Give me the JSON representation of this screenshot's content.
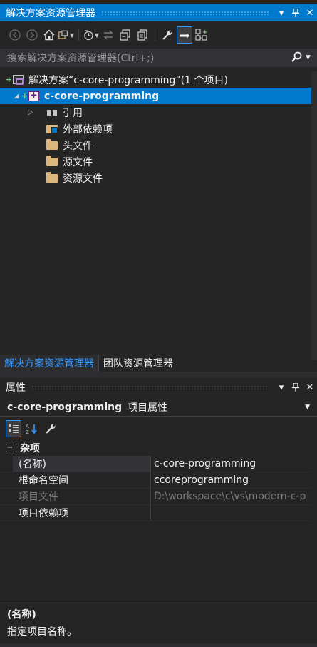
{
  "solution_explorer": {
    "title": "解决方案资源管理器",
    "title_buttons": [
      "▾",
      "⊥",
      "✕"
    ],
    "search_placeholder": "搜索解决方案资源管理器(Ctrl+;)",
    "tree": {
      "solution_label": "解决方案“c-core-programming”(1 个项目)",
      "project_label": "c-core-programming",
      "items": [
        {
          "label": "引用",
          "icon": "references-icon",
          "expandable": true
        },
        {
          "label": "外部依赖项",
          "icon": "external-dependencies-icon",
          "expandable": false
        },
        {
          "label": "头文件",
          "icon": "folder-icon",
          "expandable": false
        },
        {
          "label": "源文件",
          "icon": "folder-icon",
          "expandable": false
        },
        {
          "label": "资源文件",
          "icon": "folder-icon",
          "expandable": false
        }
      ]
    },
    "tabs": [
      "解决方案资源管理器",
      "团队资源管理器"
    ]
  },
  "properties": {
    "title": "属性",
    "title_buttons": [
      "▾",
      "⊥",
      "✕"
    ],
    "object_name": "c-core-programming",
    "object_type": "项目属性",
    "category": "杂项",
    "rows": [
      {
        "name": "(名称)",
        "value": "c-core-programming"
      },
      {
        "name": "根命名空间",
        "value": "ccoreprogramming"
      },
      {
        "name": "项目文件",
        "value": "D:\\workspace\\c\\vs\\modern-c-p"
      },
      {
        "name": "项目依赖项",
        "value": ""
      }
    ],
    "description_title": "(名称)",
    "description_text": "指定项目名称。"
  },
  "colors": {
    "accent": "#007acc",
    "background": "#252526",
    "tab_active": "#3399ff"
  }
}
